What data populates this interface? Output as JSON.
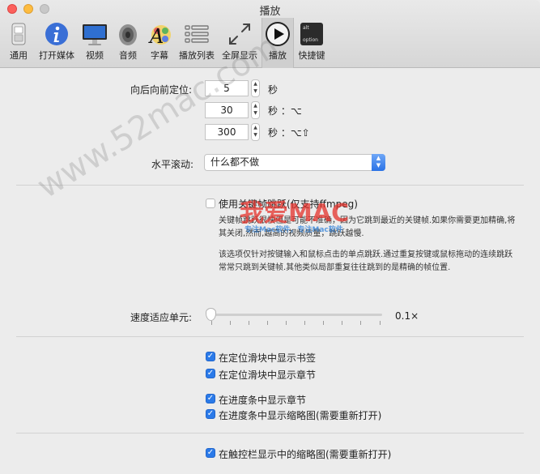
{
  "window": {
    "title": "播放"
  },
  "toolbar": [
    {
      "label": "通用",
      "icon": "switch-icon"
    },
    {
      "label": "打开媒体",
      "icon": "info-icon"
    },
    {
      "label": "视频",
      "icon": "monitor-icon"
    },
    {
      "label": "音频",
      "icon": "speaker-icon"
    },
    {
      "label": "字幕",
      "icon": "font-palette-icon"
    },
    {
      "label": "播放列表",
      "icon": "list-icon"
    },
    {
      "label": "全屏显示",
      "icon": "fullscreen-arrows-icon"
    },
    {
      "label": "播放",
      "icon": "play-icon"
    },
    {
      "label": "快捷键",
      "icon": "keyboard-key-icon"
    }
  ],
  "keys": {
    "alt": "alt",
    "option": "option"
  },
  "seek": {
    "label": "向后向前定位:",
    "rows": [
      {
        "value": "5",
        "unit": "秒"
      },
      {
        "value": "30",
        "unit": "秒 ：⌥"
      },
      {
        "value": "300",
        "unit": "秒 ：⌥⇧"
      }
    ]
  },
  "hscroll": {
    "label": "水平滚动:",
    "selected": "什么都不做"
  },
  "keyframe": {
    "label": "使用关键帧跳跃(仅支持ffmpeg)",
    "checked": false,
    "desc1": "关键帧跳跃很快但是可能不准确，因为它跳到最近的关键帧.如果你需要更加精确,将其关闭,然而,越高的视频质量，跳跃越慢.",
    "desc2": "该选项仅针对按键输入和鼠标点击的单点跳跃.通过重复按键或鼠标拖动的连续跳跃常常只跳到关键帧.其他类似局部重复往往跳到的是精确的帧位置."
  },
  "speed": {
    "label": "速度适应单元:",
    "value": "0.1×",
    "level": 0
  },
  "options": [
    {
      "label": "在定位滑块中显示书签",
      "checked": true
    },
    {
      "label": "在定位滑块中显示章节",
      "checked": true
    },
    {
      "label": "在进度条中显示章节",
      "checked": true
    },
    {
      "label": "在进度条中显示缩略图(需要重新打开)",
      "checked": true
    },
    {
      "label": "在触控栏显示中的缩略图(需要重新打开)",
      "checked": true
    }
  ],
  "watermark": {
    "site": "www.52mac.com",
    "brand": "我爱MAC",
    "brand_sub": "专注Mac软件，专注Mac软件"
  },
  "colors": {
    "accent": "#2b7ae8",
    "brand_red": "#e4322b",
    "brand_blue": "#1e78d8"
  }
}
